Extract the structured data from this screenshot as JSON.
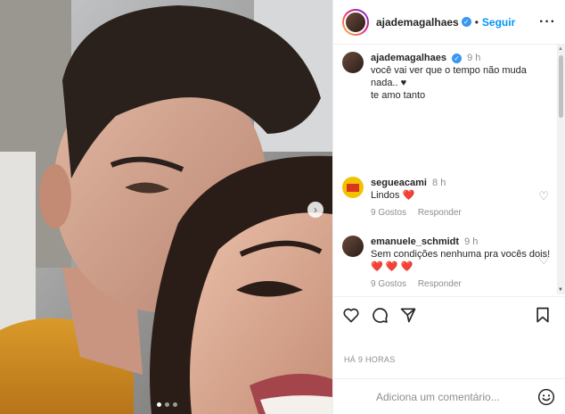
{
  "post": {
    "author": "ajademagalhaes",
    "follow_label": "Seguir",
    "more_icon": "more-options-icon",
    "photo_count": 3,
    "current_photo": 1
  },
  "caption": {
    "username": "ajademagalhaes",
    "time": "9 h",
    "line1": "você vai ver que o tempo não muda",
    "line2": "nada.. ♥",
    "line3": "te amo tanto"
  },
  "comments": [
    {
      "username": "segueacami",
      "time": "8 h",
      "text": "Lindos ❤️",
      "likes": "9 Gostos",
      "reply": "Responder"
    },
    {
      "username": "emanuele_schmidt",
      "time": "9 h",
      "text": "Sem condições nenhuma pra vocês dois! ❤️ ❤️ ❤️",
      "likes": "9 Gostos",
      "reply": "Responder"
    }
  ],
  "posted_ago": "HÁ 9 HORAS",
  "add_comment": {
    "placeholder": "Adiciona um comentário..."
  },
  "icons": {
    "like": "heart-icon",
    "comment": "comment-icon",
    "share": "share-icon",
    "save": "bookmark-icon",
    "emoji": "emoji-icon",
    "next": "chevron-right-icon"
  },
  "colors": {
    "accent": "#0095f6",
    "verified": "#3897f0",
    "heart": "#ed4956"
  }
}
